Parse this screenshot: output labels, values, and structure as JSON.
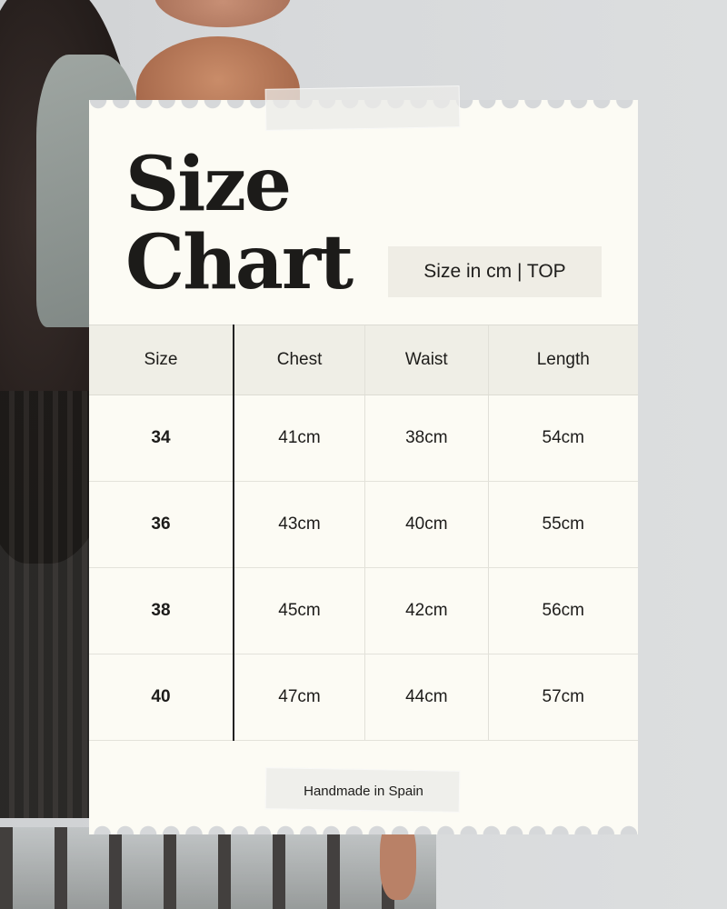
{
  "card": {
    "title_line1": "Size",
    "title_line2": "Chart",
    "subtitle": "Size in cm | TOP",
    "footer": "Handmade in Spain"
  },
  "table": {
    "headers": [
      "Size",
      "Chest",
      "Waist",
      "Length"
    ],
    "rows": [
      [
        "34",
        "41cm",
        "38cm",
        "54cm"
      ],
      [
        "36",
        "43cm",
        "40cm",
        "55cm"
      ],
      [
        "38",
        "45cm",
        "42cm",
        "56cm"
      ],
      [
        "40",
        "47cm",
        "44cm",
        "57cm"
      ]
    ]
  },
  "colors": {
    "card_background": "#fcfbf4",
    "header_background": "#efeee6",
    "text": "#1d1c1a"
  }
}
